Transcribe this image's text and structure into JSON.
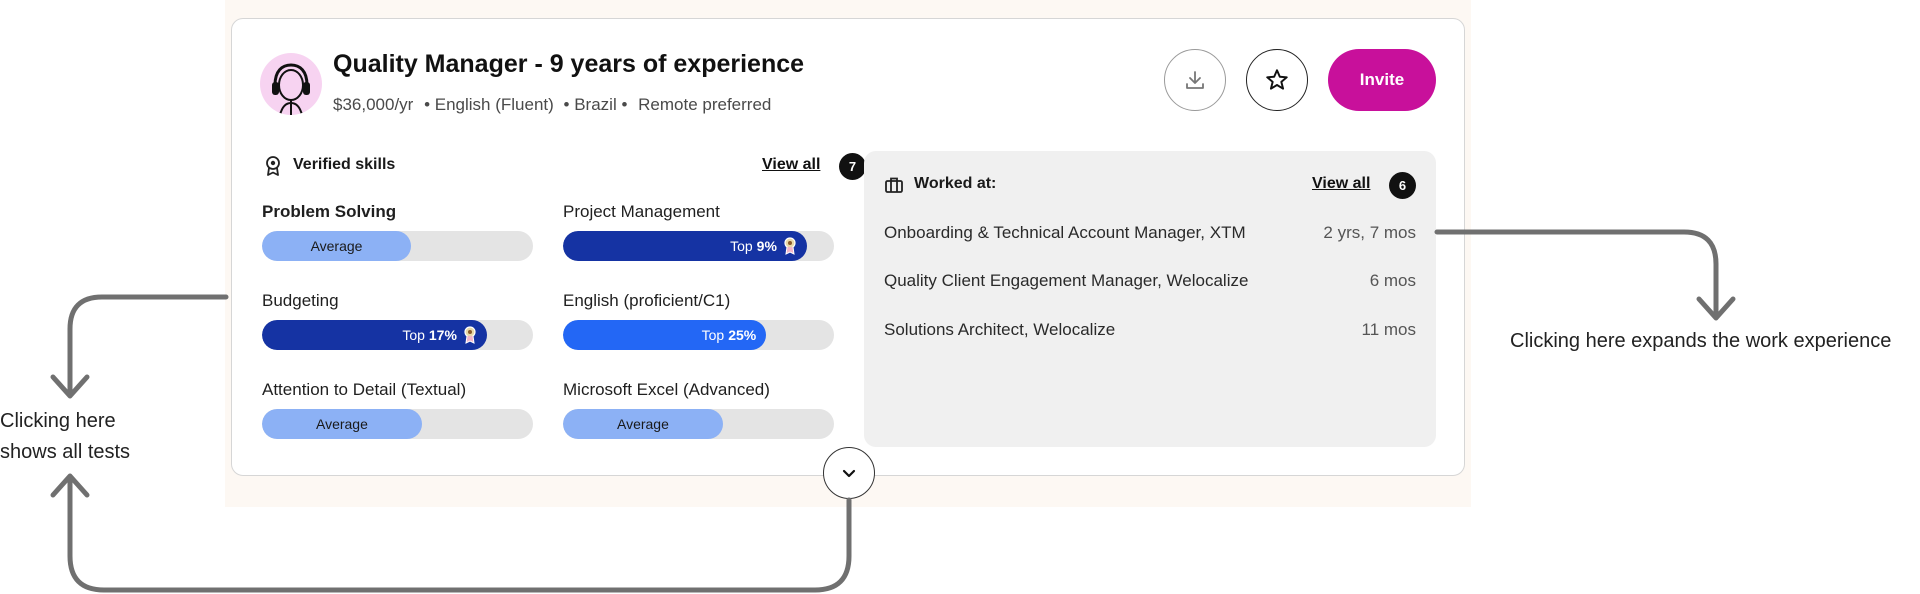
{
  "profile": {
    "title": "Quality Manager - 9 years of experience",
    "salary": "$36,000/yr",
    "language": "• English (Fluent)",
    "country": "• Brazil •",
    "work_pref": "Remote preferred",
    "avatar_icon": "headset-person-icon"
  },
  "actions": {
    "download_icon": "download-icon",
    "star_icon": "star-icon",
    "invite_label": "Invite",
    "invite_color": "#c8109b"
  },
  "skills": {
    "header_icon": "award-badge-icon",
    "title": "Verified skills",
    "view_all": "View all",
    "count": "7",
    "items": [
      {
        "name": "Problem Solving",
        "result": "Average",
        "fraction": 0.55
      },
      {
        "name": "Project Management",
        "prefix": "Top",
        "value": "9%",
        "fraction": 0.9,
        "medal": true
      },
      {
        "name": "Budgeting",
        "prefix": "Top",
        "value": "17%",
        "fraction": 0.83,
        "medal": true
      },
      {
        "name": "English (proficient/C1)",
        "prefix": "Top",
        "value": "25%",
        "fraction": 0.75,
        "medal": false
      },
      {
        "name": "Attention to Detail (Textual)",
        "result": "Average",
        "fraction": 0.59
      },
      {
        "name": "Microsoft Excel (Advanced)",
        "result": "Average",
        "fraction": 0.59
      }
    ],
    "colors": {
      "average": "#8cb1f5",
      "top_dark": "#1533a3",
      "top_bright": "#2367f5",
      "track": "#e4e4e4"
    }
  },
  "worked": {
    "icon": "briefcase-icon",
    "title": "Worked at:",
    "view_all": "View all",
    "count": "6",
    "jobs": [
      {
        "role": "Onboarding & Technical Account Manager, XTM",
        "duration": "2 yrs, 7 mos"
      },
      {
        "role": "Quality Client Engagement Manager, Welocalize",
        "duration": "6 mos"
      },
      {
        "role": "Solutions Architect, Welocalize",
        "duration": "11 mos"
      }
    ]
  },
  "expand_icon": "chevron-down-icon",
  "annotations": {
    "left_line1": "Clicking here",
    "left_line2": "shows all tests",
    "right": "Clicking here expands the work experience"
  }
}
